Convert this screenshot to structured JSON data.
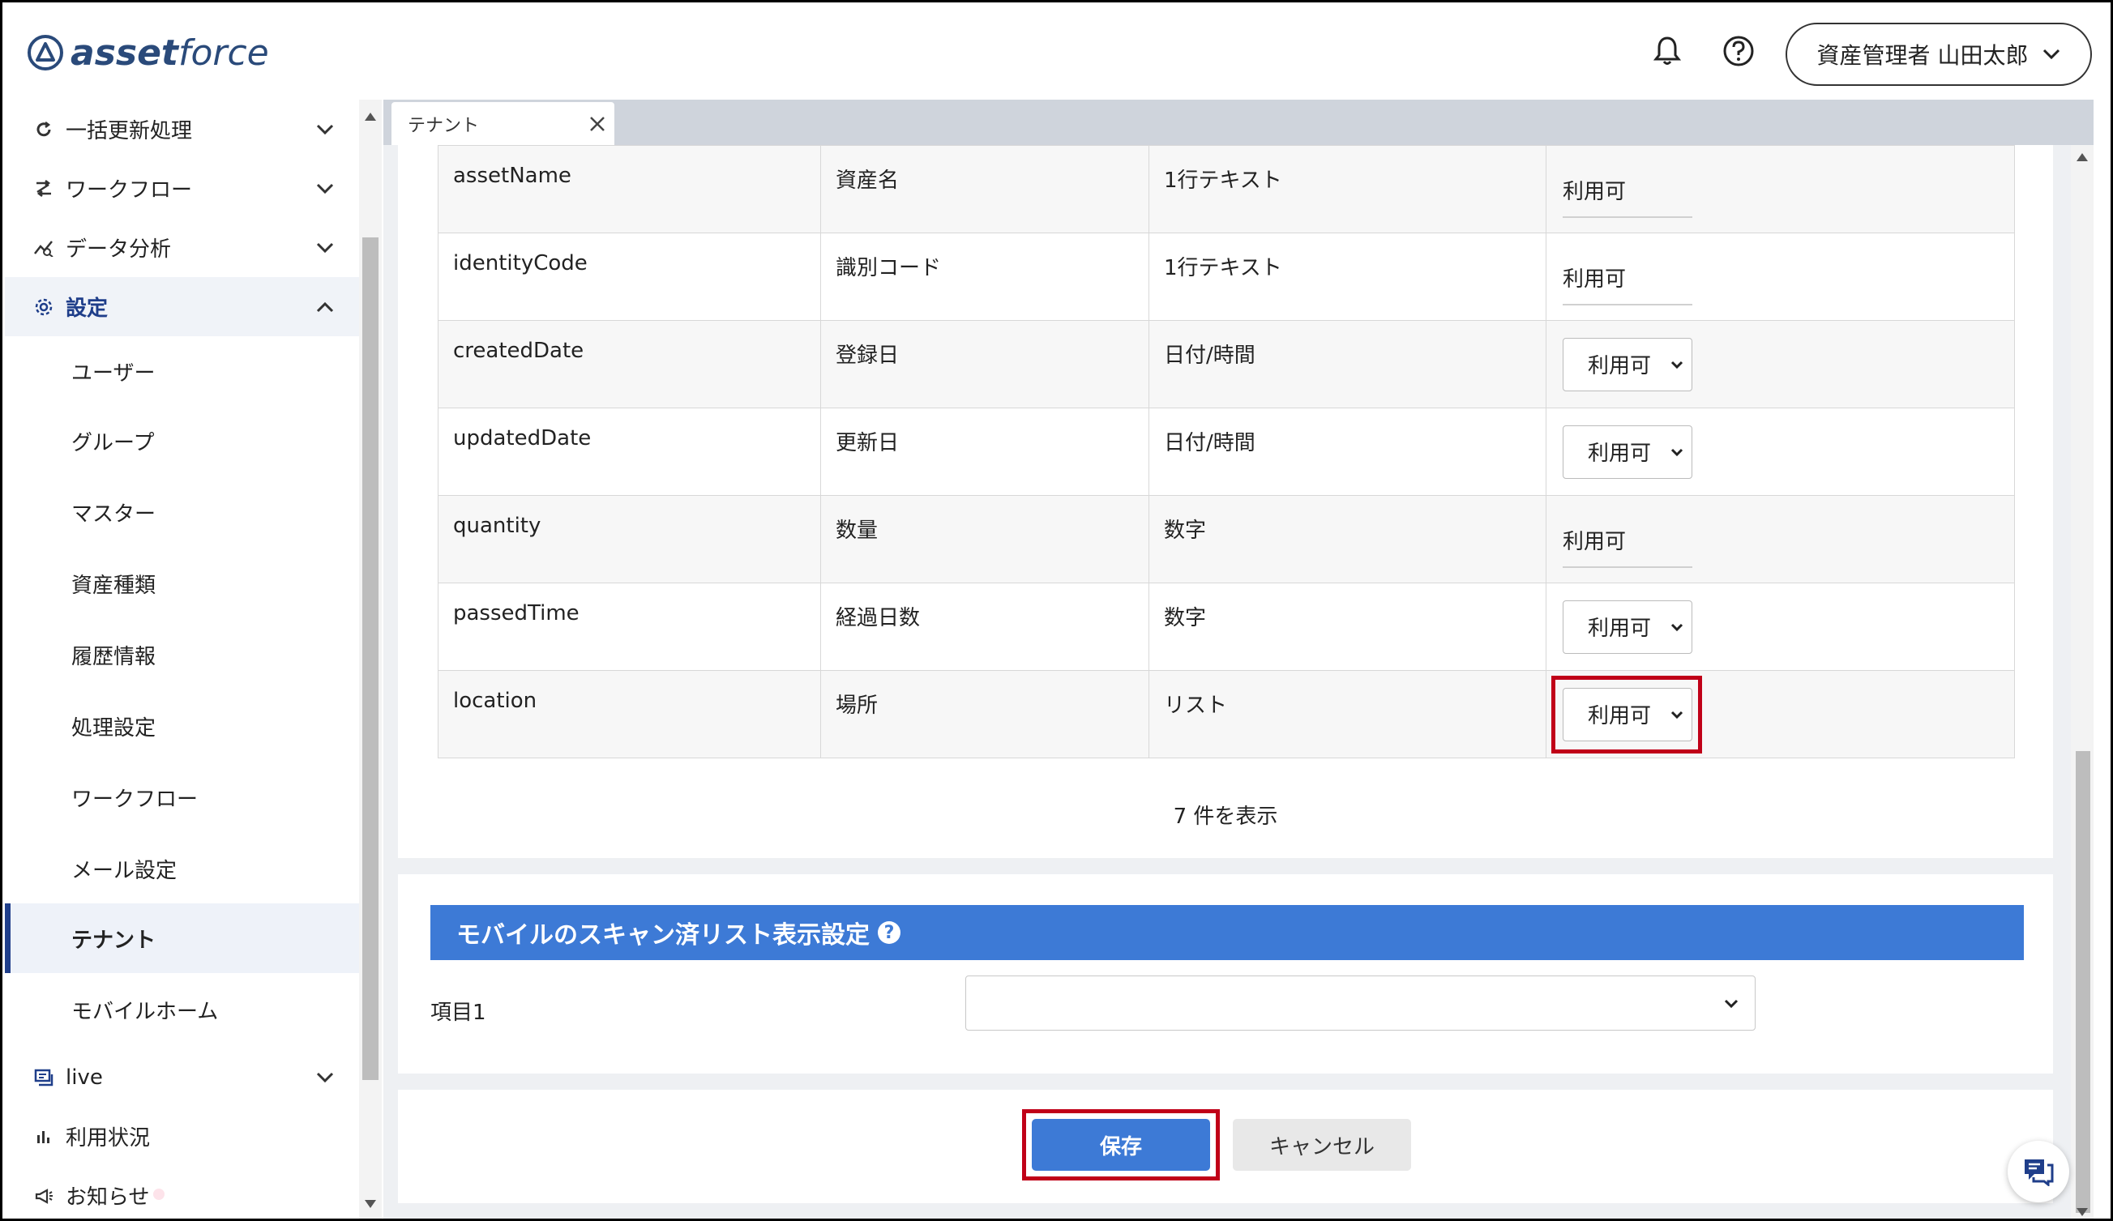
{
  "header": {
    "logo_text_bold": "asset",
    "logo_text_light": "force",
    "user_label": "資産管理者 山田太郎"
  },
  "sidebar": {
    "top_items": [
      {
        "label": "一括更新処理",
        "icon": "refresh-icon"
      },
      {
        "label": "ワークフロー",
        "icon": "workflow-icon"
      },
      {
        "label": "データ分析",
        "icon": "analytics-icon"
      },
      {
        "label": "設定",
        "icon": "gear-icon"
      }
    ],
    "sub_items": [
      "ユーザー",
      "グループ",
      "マスター",
      "資産種類",
      "履歴情報",
      "処理設定",
      "ワークフロー",
      "メール設定",
      "テナント",
      "モバイルホーム"
    ],
    "selected_sub": "テナント",
    "bottom_items": [
      {
        "label": "live",
        "icon": "live-icon"
      },
      {
        "label": "利用状況",
        "icon": "bar-chart-icon"
      },
      {
        "label": "お知らせ",
        "icon": "megaphone-icon"
      }
    ]
  },
  "tab": {
    "label": "テナント"
  },
  "fields_table": {
    "rows": [
      {
        "key": "assetName",
        "name": "資産名",
        "type": "1行テキスト",
        "value": "利用可",
        "control": "plain"
      },
      {
        "key": "identityCode",
        "name": "識別コード",
        "type": "1行テキスト",
        "value": "利用可",
        "control": "plain"
      },
      {
        "key": "createdDate",
        "name": "登録日",
        "type": "日付/時間",
        "value": "利用可",
        "control": "select"
      },
      {
        "key": "updatedDate",
        "name": "更新日",
        "type": "日付/時間",
        "value": "利用可",
        "control": "select"
      },
      {
        "key": "quantity",
        "name": "数量",
        "type": "数字",
        "value": "利用可",
        "control": "plain"
      },
      {
        "key": "passedTime",
        "name": "経過日数",
        "type": "数字",
        "value": "利用可",
        "control": "select"
      },
      {
        "key": "location",
        "name": "場所",
        "type": "リスト",
        "value": "利用可",
        "control": "select"
      }
    ],
    "count_text": "7 件を表示"
  },
  "mobile_section": {
    "title": "モバイルのスキャン済リスト表示設定",
    "help_glyph": "?",
    "field_label": "項目1",
    "field_value": ""
  },
  "actions": {
    "save_label": "保存",
    "cancel_label": "キャンセル"
  },
  "colors": {
    "accent": "#3d7ad6",
    "highlight": "#c00018",
    "brand": "#2a4a7a"
  }
}
